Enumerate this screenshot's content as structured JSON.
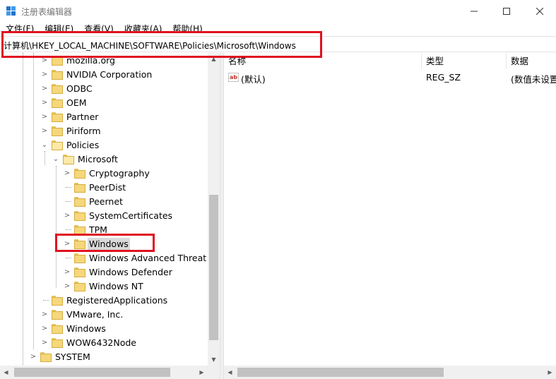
{
  "window": {
    "title": "注册表编辑器",
    "icon": "regedit-icon",
    "controls": {
      "minimize": "minimize-icon",
      "maximize": "maximize-icon",
      "close": "close-icon"
    }
  },
  "menu": {
    "items": [
      "文件(F)",
      "编辑(E)",
      "查看(V)",
      "收藏夹(A)",
      "帮助(H)"
    ]
  },
  "address": {
    "path": "计算机\\HKEY_LOCAL_MACHINE\\SOFTWARE\\Policies\\Microsoft\\Windows"
  },
  "tree": {
    "items": [
      {
        "label": "mozilla.org",
        "expandable": true
      },
      {
        "label": "NVIDIA Corporation",
        "expandable": true
      },
      {
        "label": "ODBC",
        "expandable": true
      },
      {
        "label": "OEM",
        "expandable": true
      },
      {
        "label": "Partner",
        "expandable": true
      },
      {
        "label": "Piriform",
        "expandable": true
      },
      {
        "label": "Policies",
        "expandable": true,
        "expanded": true
      },
      {
        "label": "Microsoft",
        "expandable": true,
        "expanded": true
      },
      {
        "label": "Cryptography",
        "expandable": true
      },
      {
        "label": "PeerDist",
        "expandable": false
      },
      {
        "label": "Peernet",
        "expandable": false
      },
      {
        "label": "SystemCertificates",
        "expandable": true
      },
      {
        "label": "TPM",
        "expandable": false
      },
      {
        "label": "Windows",
        "expandable": true,
        "selected": true
      },
      {
        "label": "Windows Advanced Threat Pr",
        "expandable": false
      },
      {
        "label": "Windows Defender",
        "expandable": true
      },
      {
        "label": "Windows NT",
        "expandable": true
      },
      {
        "label": "RegisteredApplications",
        "expandable": false
      },
      {
        "label": "VMware, Inc.",
        "expandable": true
      },
      {
        "label": "Windows",
        "expandable": true
      },
      {
        "label": "WOW6432Node",
        "expandable": true
      },
      {
        "label": "SYSTEM",
        "expandable": true
      }
    ]
  },
  "values": {
    "columns": {
      "name": "名称",
      "type": "类型",
      "data": "数据"
    },
    "rows": [
      {
        "name": "(默认)",
        "type": "REG_SZ",
        "data": "(数值未设置",
        "icon": "string-value-icon"
      }
    ]
  },
  "highlight_color": "#e0121f"
}
